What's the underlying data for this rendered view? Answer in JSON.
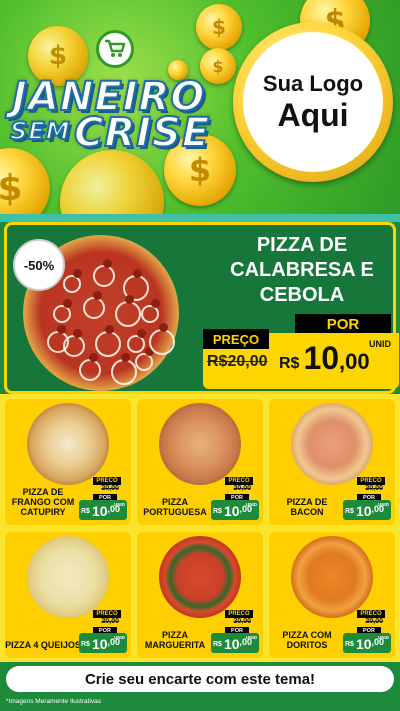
{
  "header": {
    "title_line1": "JANEIRO",
    "title_line2a": "SEM",
    "title_line2b": "CRISE",
    "logo_line1": "Sua Logo",
    "logo_line2": "Aqui",
    "cart_icon": "shopping-cart-icon",
    "coin_symbol": "$"
  },
  "hero": {
    "discount": "-50%",
    "title": "PIZZA DE CALABRESA E CEBOLA",
    "preco_label": "PREÇO",
    "old_price": "R$20,00",
    "por_label": "POR",
    "currency": "R$",
    "price_int": "10",
    "price_cents": ",00",
    "unit": "UNID"
  },
  "products": [
    {
      "name": "PIZZA DE FRANGO COM CATUPIRY",
      "preco_label": "PRECO",
      "old_price": "20,00",
      "por_label": "POR",
      "currency": "R$",
      "price_int": "10",
      "price_cents": ",00",
      "unit": "UNID"
    },
    {
      "name": "PIZZA PORTUGUESA",
      "preco_label": "PRECO",
      "old_price": "20,00",
      "por_label": "POR",
      "currency": "R$",
      "price_int": "10",
      "price_cents": ",00",
      "unit": "UNID"
    },
    {
      "name": "PIZZA DE BACON",
      "preco_label": "PRECO",
      "old_price": "20,00",
      "por_label": "POR",
      "currency": "R$",
      "price_int": "10",
      "price_cents": ",00",
      "unit": "UNID"
    },
    {
      "name": "PIZZA 4 QUEIJOS",
      "preco_label": "PRECO",
      "old_price": "20,00",
      "por_label": "POR",
      "currency": "R$",
      "price_int": "10",
      "price_cents": ",00",
      "unit": "UNID"
    },
    {
      "name": "PIZZA MARGUERITA",
      "preco_label": "PRECO",
      "old_price": "20,00",
      "por_label": "POR",
      "currency": "R$",
      "price_int": "10",
      "price_cents": ",00",
      "unit": "UNID"
    },
    {
      "name": "PIZZA COM DORITOS",
      "preco_label": "PRECO",
      "old_price": "20,00",
      "por_label": "POR",
      "currency": "R$",
      "price_int": "10",
      "price_cents": ",00",
      "unit": "UNID"
    }
  ],
  "footer": {
    "cta": "Crie seu encarte com este tema!",
    "note": "*Imagens Meramente Ilustrativas"
  },
  "colors": {
    "brand_green": "#1e8a3c",
    "accent_yellow": "#fdd600",
    "title_blue": "#1e6fa8"
  }
}
